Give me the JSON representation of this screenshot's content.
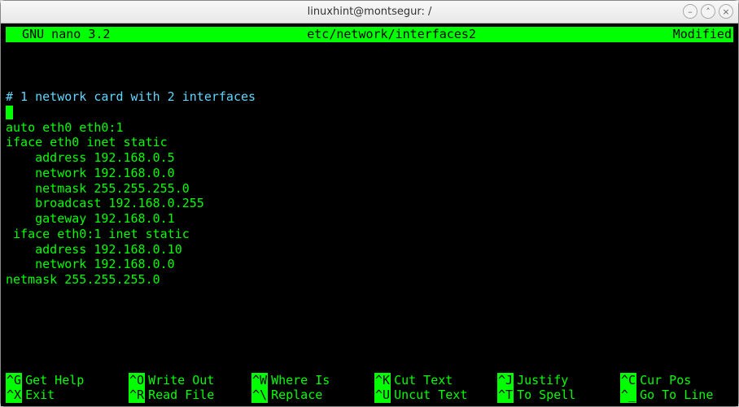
{
  "window": {
    "title": "linuxhint@montsegur: /"
  },
  "nano": {
    "app": "  GNU nano 3.2",
    "file": "etc/network/interfaces2",
    "status": "Modified"
  },
  "content": {
    "blank1": "",
    "blank2": "",
    "comment": "# 1 network card with 2 interfaces",
    "l0": "",
    "l1": "auto eth0 eth0:1",
    "l2": "iface eth0 inet static",
    "l3": "    address 192.168.0.5",
    "l4": "    network 192.168.0.0",
    "l5": "    netmask 255.255.255.0",
    "l6": "    broadcast 192.168.0.255",
    "l7": "    gateway 192.168.0.1",
    "l8": " iface eth0:1 inet static",
    "l9": "    address 192.168.0.10",
    "l10": "    network 192.168.0.0",
    "l11": "netmask 255.255.255.0"
  },
  "shortcuts": {
    "r1c1": {
      "key": "^G",
      "label": "Get Help"
    },
    "r1c2": {
      "key": "^O",
      "label": "Write Out"
    },
    "r1c3": {
      "key": "^W",
      "label": "Where Is"
    },
    "r1c4": {
      "key": "^K",
      "label": "Cut Text"
    },
    "r1c5": {
      "key": "^J",
      "label": "Justify"
    },
    "r1c6": {
      "key": "^C",
      "label": "Cur Pos"
    },
    "r2c1": {
      "key": "^X",
      "label": "Exit"
    },
    "r2c2": {
      "key": "^R",
      "label": "Read File"
    },
    "r2c3": {
      "key": "^\\",
      "label": "Replace"
    },
    "r2c4": {
      "key": "^U",
      "label": "Uncut Text"
    },
    "r2c5": {
      "key": "^T",
      "label": "To Spell"
    },
    "r2c6": {
      "key": "^_",
      "label": "Go To Line"
    }
  }
}
